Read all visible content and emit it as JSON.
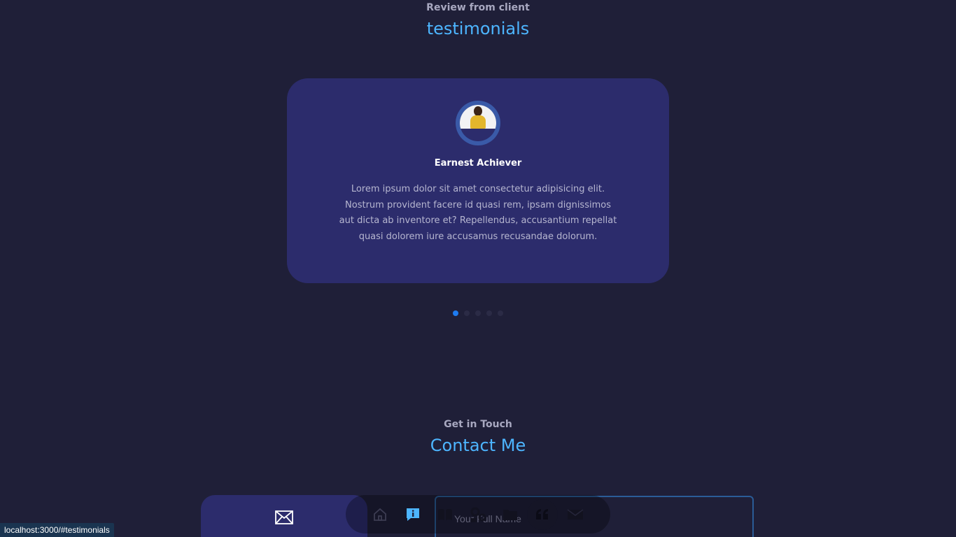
{
  "testimonials": {
    "subtitle": "Review from client",
    "title": "testimonials",
    "active_index": 0,
    "dot_count": 5,
    "card": {
      "name": "Earnest Achiever",
      "review": "Lorem ipsum dolor sit amet consectetur adipisicing elit. Nostrum provident facere id quasi rem, ipsam dignissimos aut dicta ab inventore et? Repellendus, accusantium repellat quasi dolorem iure accusamus recusandae dolorum."
    }
  },
  "contact": {
    "subtitle": "Get in Touch",
    "title": "Contact Me",
    "option_icon": "envelope-icon",
    "form": {
      "name_placeholder": "Your Full Name",
      "name_value": ""
    }
  },
  "nav": {
    "items": [
      {
        "icon": "home-icon",
        "active": false
      },
      {
        "icon": "info-icon",
        "active": true
      },
      {
        "icon": "book-icon",
        "active": false
      },
      {
        "icon": "services-icon",
        "active": false
      },
      {
        "icon": "folder-icon",
        "active": false
      },
      {
        "icon": "quote-icon",
        "active": false
      },
      {
        "icon": "mail-icon",
        "active": false
      }
    ]
  },
  "status_bar": {
    "url": "localhost:3000/#testimonials"
  },
  "colors": {
    "background": "#1f1f38",
    "card": "#2c2c6c",
    "accent": "#4db5ff",
    "dot_active": "#1e7bf0"
  }
}
